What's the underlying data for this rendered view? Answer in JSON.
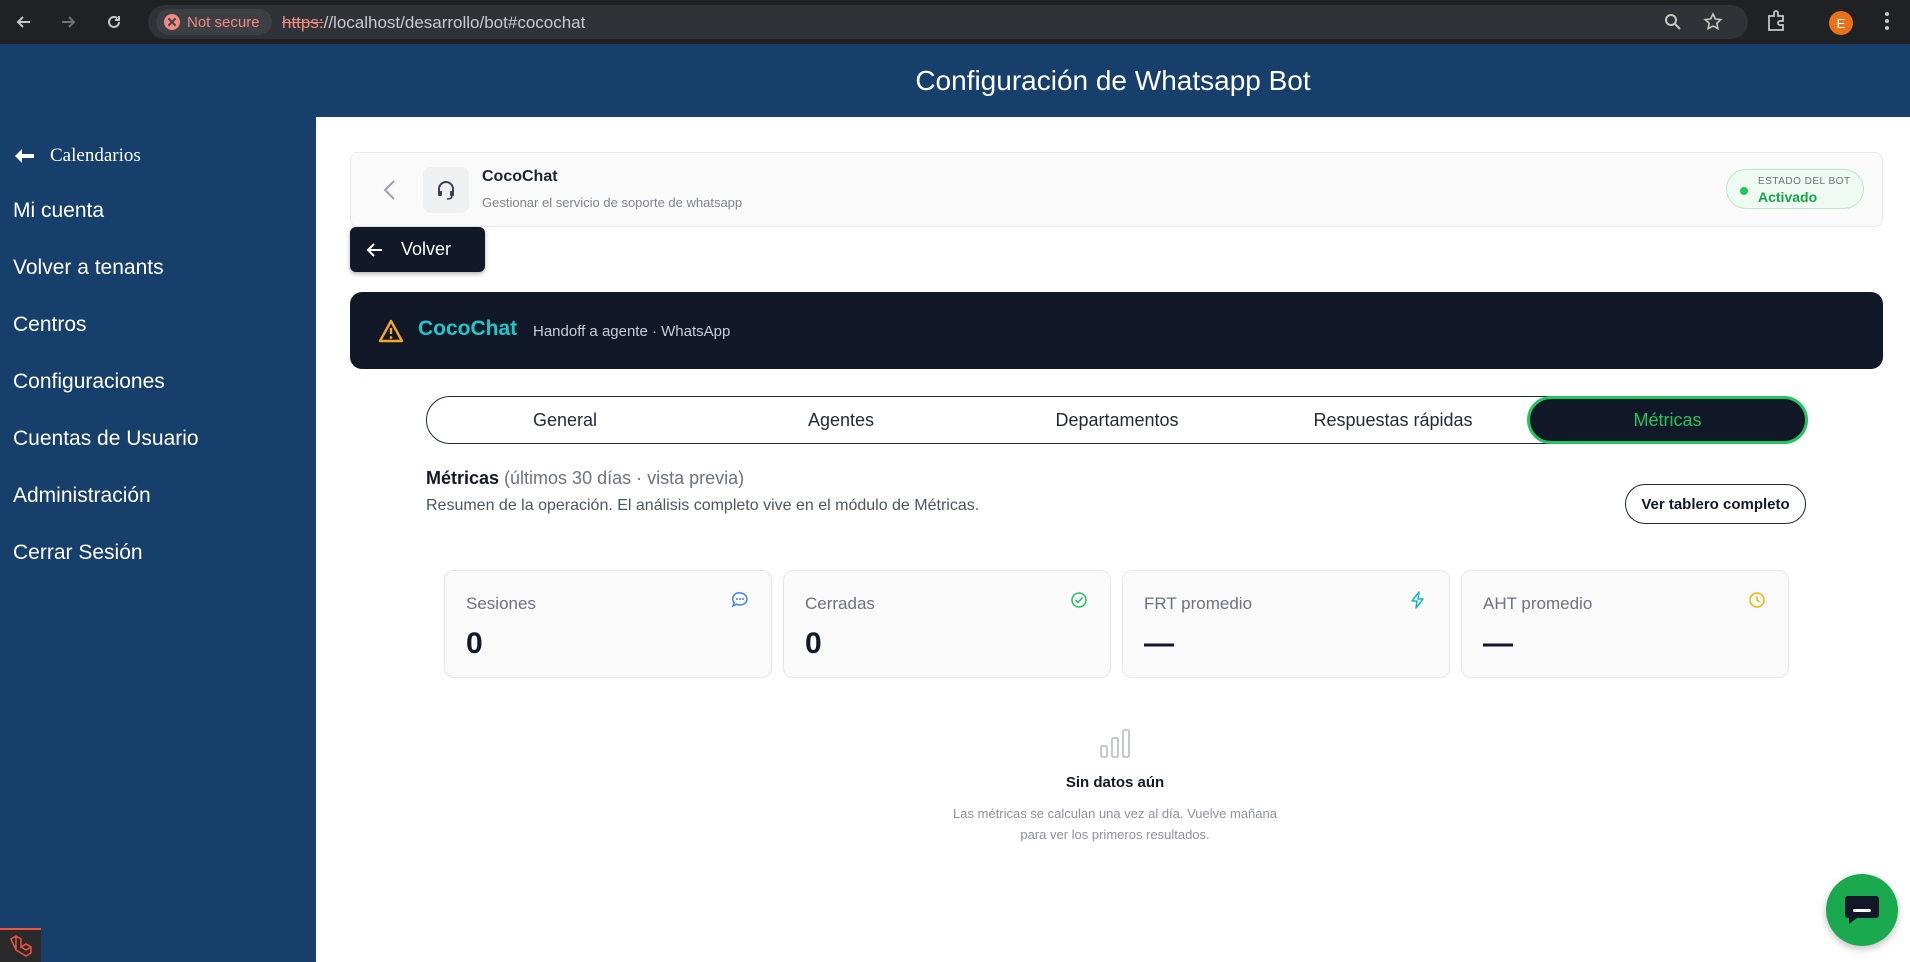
{
  "browser": {
    "security_label": "Not secure",
    "url_scheme": "https:",
    "url_rest": "//localhost/desarrollo/bot#cocochat",
    "profile_initial": "E"
  },
  "page": {
    "title": "Configuración de Whatsapp Bot"
  },
  "sidebar": {
    "calendar_link": "Calendarios",
    "items": [
      {
        "label": "Mi cuenta"
      },
      {
        "label": "Volver a tenants"
      },
      {
        "label": "Centros"
      },
      {
        "label": "Configuraciones"
      },
      {
        "label": "Cuentas de Usuario"
      },
      {
        "label": "Administración"
      },
      {
        "label": "Cerrar Sesión"
      }
    ]
  },
  "header_card": {
    "title": "CocoChat",
    "subtitle": "Gestionar el servicio de soporte de whatsapp",
    "status_label": "ESTADO DEL BOT",
    "status_value": "Activado"
  },
  "volver_label": "Volver",
  "banner": {
    "brand": "CocoChat",
    "subtitle": "Handoff a agente · WhatsApp"
  },
  "tabs": [
    {
      "label": "General",
      "active": false
    },
    {
      "label": "Agentes",
      "active": false
    },
    {
      "label": "Departamentos",
      "active": false
    },
    {
      "label": "Respuestas rápidas",
      "active": false
    },
    {
      "label": "Métricas",
      "active": true
    }
  ],
  "metrics": {
    "title": "Métricas",
    "note": " (últimos 30 días · vista previa)",
    "description": "Resumen de la operación. El análisis completo vive en el módulo de Métricas.",
    "full_dashboard_button": "Ver tablero completo",
    "kpis": [
      {
        "label": "Sesiones",
        "value": "0",
        "icon": "chat-bubble-icon",
        "color": "#3b82f6"
      },
      {
        "label": "Cerradas",
        "value": "0",
        "icon": "check-circle-icon",
        "color": "#22c55e"
      },
      {
        "label": "FRT promedio",
        "value": "—",
        "icon": "lightning-icon",
        "color": "#14b8c8"
      },
      {
        "label": "AHT promedio",
        "value": "—",
        "icon": "clock-icon",
        "color": "#f5b400"
      }
    ],
    "empty_state": {
      "title": "Sin datos aún",
      "line1": "Las métricas se calculan una vez al día. Vuelve mañana",
      "line2": "para ver los primeros resultados."
    }
  },
  "colors": {
    "sidebar": "#163f6b",
    "dark": "#111827",
    "accent_green": "#22c55e",
    "brand_teal": "#1ec8c8"
  }
}
